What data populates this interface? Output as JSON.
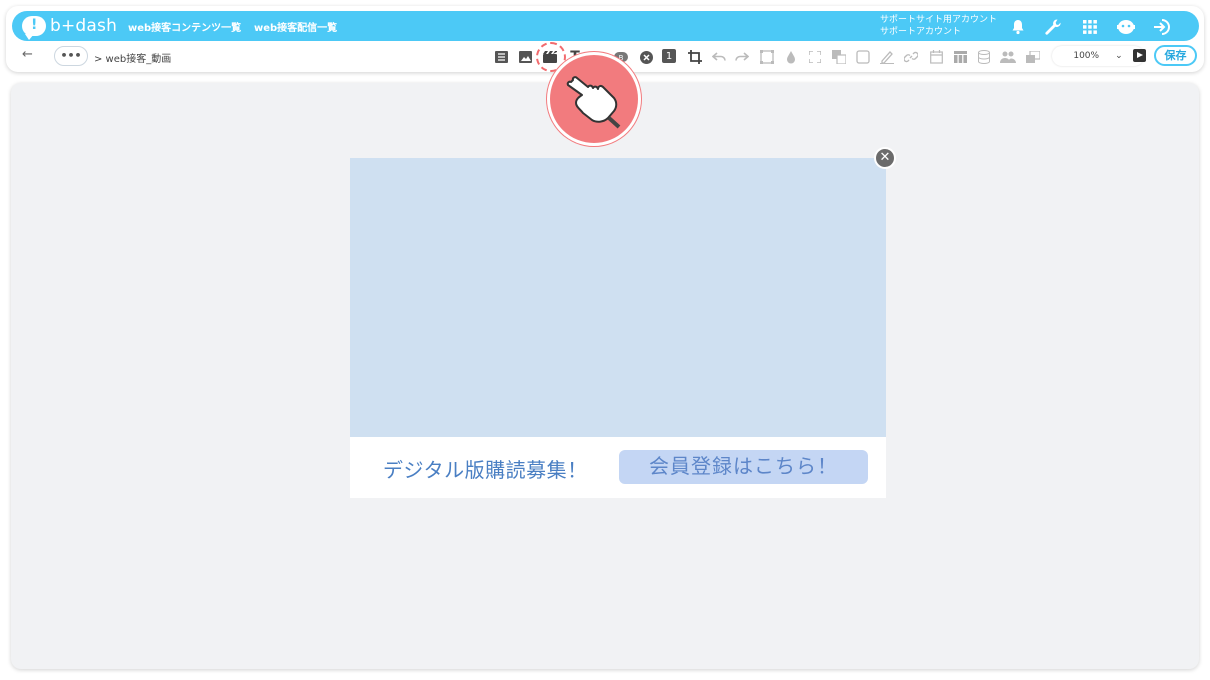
{
  "logo": {
    "text": "b+dash",
    "bubble": "!"
  },
  "nav": {
    "link1": "web接客コンテンツ一覧",
    "link2": "web接客配信一覧"
  },
  "account": {
    "line1": "サポートサイト用アカウント",
    "line2": "サポートアカウント"
  },
  "icons": [
    "bell-icon",
    "wrench-icon",
    "grid-icon",
    "bot-icon",
    "logout-icon"
  ],
  "subbar": {
    "back": "←",
    "more": "•••",
    "breadcrumb": "> web接客_動画"
  },
  "toolbar": {
    "text_tool": "T",
    "badge_one": "1",
    "badge_small": "B",
    "zoom_value": "100%",
    "zoom_caret": "⌄",
    "save_label": "保存"
  },
  "popup": {
    "text": "デジタル版購読募集！",
    "cta_label": "会員登録はこちら！",
    "close": "✕"
  },
  "colors": {
    "brand": "#4cc9f6",
    "popup_bg": "#cfe0f1",
    "cta_bg": "#c4d6f4",
    "pointer": "#f27b7e"
  }
}
